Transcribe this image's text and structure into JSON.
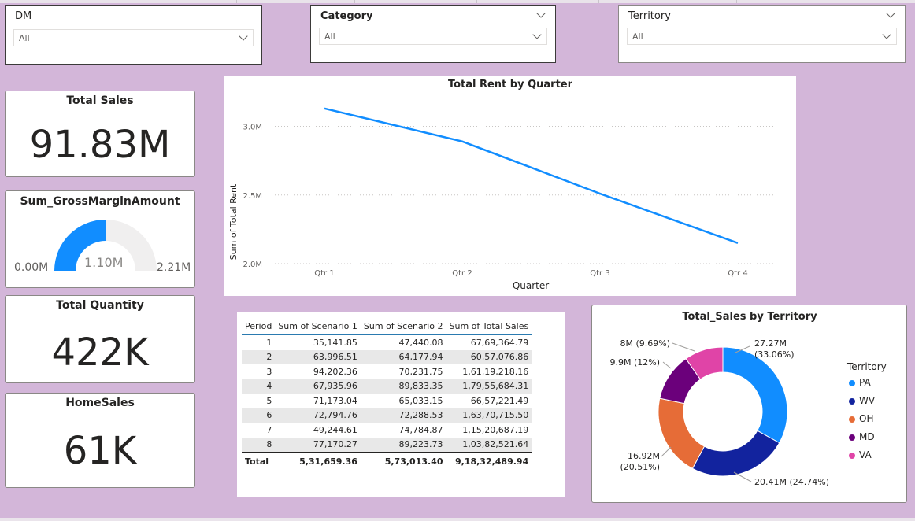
{
  "slicers": [
    {
      "title": "DM",
      "value": "All"
    },
    {
      "title": "Category",
      "value": "All"
    },
    {
      "title": "Territory",
      "value": "All"
    }
  ],
  "cards": {
    "total_sales": {
      "title": "Total Sales",
      "value": "91.83M"
    },
    "gross_margin": {
      "title": "Sum_GrossMarginAmount",
      "value": "1.10M",
      "min": "0.00M",
      "max": "2.21M",
      "fraction": 0.5
    },
    "total_quantity": {
      "title": "Total Quantity",
      "value": "422K"
    },
    "home_sales": {
      "title": "HomeSales",
      "value": "61K"
    }
  },
  "colors": {
    "accent": "#118dff",
    "PA": "#118dff",
    "WV": "#12239e",
    "OH": "#e66c37",
    "MD": "#6b007b",
    "VA": "#e044a7",
    "background": "#d3b6d9"
  },
  "chart_data": [
    {
      "type": "line",
      "title": "Total Rent by Quarter",
      "xlabel": "Quarter",
      "ylabel": "Sum of Total Rent",
      "categories": [
        "Qtr 1",
        "Qtr 2",
        "Qtr 3",
        "Qtr 4"
      ],
      "values": [
        3.13,
        2.89,
        2.51,
        2.15
      ],
      "unit": "M",
      "yticks": [
        "2.0M",
        "2.5M",
        "3.0M"
      ],
      "ytick_values": [
        2.0,
        2.5,
        3.0
      ],
      "ylim": [
        2.0,
        3.1
      ],
      "grid": true
    },
    {
      "type": "pie",
      "title": "Total_Sales by Territory",
      "legend_title": "Territory",
      "legend_position": "right",
      "categories": [
        "PA",
        "WV",
        "OH",
        "MD",
        "VA"
      ],
      "values": [
        27.27,
        20.41,
        16.92,
        9.9,
        8
      ],
      "percent": [
        33.06,
        24.74,
        20.51,
        12,
        9.69
      ],
      "labels": [
        "27.27M",
        "20.41M (24.74%)",
        "16.92M",
        "9.9M (12%)",
        "8M (9.69%)"
      ],
      "labels_line2": [
        "(33.06%)",
        "",
        "(20.51%)",
        "",
        ""
      ],
      "donut": true
    }
  ],
  "matrix": {
    "columns": [
      "Period",
      "Sum of Scenario 1",
      "Sum of Scenario 2",
      "Sum of Total Sales"
    ],
    "rows": [
      [
        "1",
        "35,141.85",
        "47,440.08",
        "67,69,364.79"
      ],
      [
        "2",
        "63,996.51",
        "64,177.94",
        "60,57,076.86"
      ],
      [
        "3",
        "94,202.36",
        "70,231.75",
        "1,61,19,218.16"
      ],
      [
        "4",
        "67,935.96",
        "89,833.35",
        "1,79,55,684.31"
      ],
      [
        "5",
        "71,173.04",
        "65,033.15",
        "66,57,221.49"
      ],
      [
        "6",
        "72,794.76",
        "72,288.53",
        "1,63,70,715.50"
      ],
      [
        "7",
        "49,244.61",
        "74,784.87",
        "1,15,20,687.19"
      ],
      [
        "8",
        "77,170.27",
        "89,223.73",
        "1,03,82,521.64"
      ]
    ],
    "total": [
      "Total",
      "5,31,659.36",
      "5,73,013.40",
      "9,18,32,489.94"
    ]
  }
}
